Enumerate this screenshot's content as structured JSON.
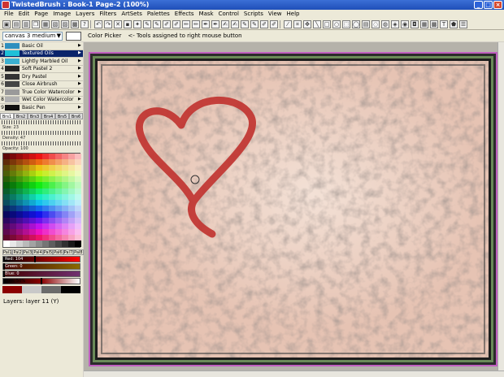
{
  "window": {
    "title": "TwistedBrush : Book-1 Page-2 (100%)",
    "controls": [
      "_",
      "□",
      "×"
    ]
  },
  "menu": [
    "File",
    "Edit",
    "Page",
    "Image",
    "Layers",
    "Filters",
    "ArtSets",
    "Palettes",
    "Effects",
    "Mask",
    "Control",
    "Scripts",
    "View",
    "Help"
  ],
  "options": {
    "preset": "canvas 3 medium",
    "tool_name": "Color Picker",
    "tool_hint": "<- Tools assigned to right mouse button"
  },
  "brushes": [
    {
      "num": "1",
      "label": "Basic Oil",
      "color": "#2e8fbf"
    },
    {
      "num": "2",
      "label": "Textured Oils",
      "color": "#1fc0d8"
    },
    {
      "num": "3",
      "label": "Lightly Marbled Oil",
      "color": "#3bb0d0"
    },
    {
      "num": "4",
      "label": "Soft Pastel 2",
      "color": "#222222"
    },
    {
      "num": "5",
      "label": "Dry Pastel",
      "color": "#333333"
    },
    {
      "num": "6",
      "label": "Close Airbrush",
      "color": "#444444"
    },
    {
      "num": "7",
      "label": "True Color Watercolor",
      "color": "#9a9a9a"
    },
    {
      "num": "8",
      "label": "Wet Color Watercolor",
      "color": "#b0b0b0"
    },
    {
      "num": "9",
      "label": "Basic Pen",
      "color": "#111111"
    }
  ],
  "brush_tabs": [
    "Brs1",
    "Brs2",
    "Brs3",
    "Brs4",
    "Brs5",
    "Brs6"
  ],
  "props": {
    "size": "Size: 23",
    "density": "Density: 47",
    "opacity": "Opacity: 100"
  },
  "palette_tabs": [
    "Pal1",
    "Pal2",
    "Pal3",
    "Pal4",
    "Pal5",
    "Pal6",
    "Pal7",
    "Pal8"
  ],
  "sliders": {
    "red": {
      "label": "Red: 104",
      "level": 0.41
    },
    "green": {
      "label": "Green: 0",
      "level": 0.0
    },
    "blue": {
      "label": "Blue: 0",
      "level": 0.0
    },
    "lum": {
      "label": "Lum: 50%",
      "level": 0.5
    }
  },
  "current_colors": [
    "#8b0000",
    "#c8c8c8",
    "#6b6b6b",
    "#000000"
  ],
  "layers": {
    "label": "Layers: layer 11 (Y)"
  }
}
